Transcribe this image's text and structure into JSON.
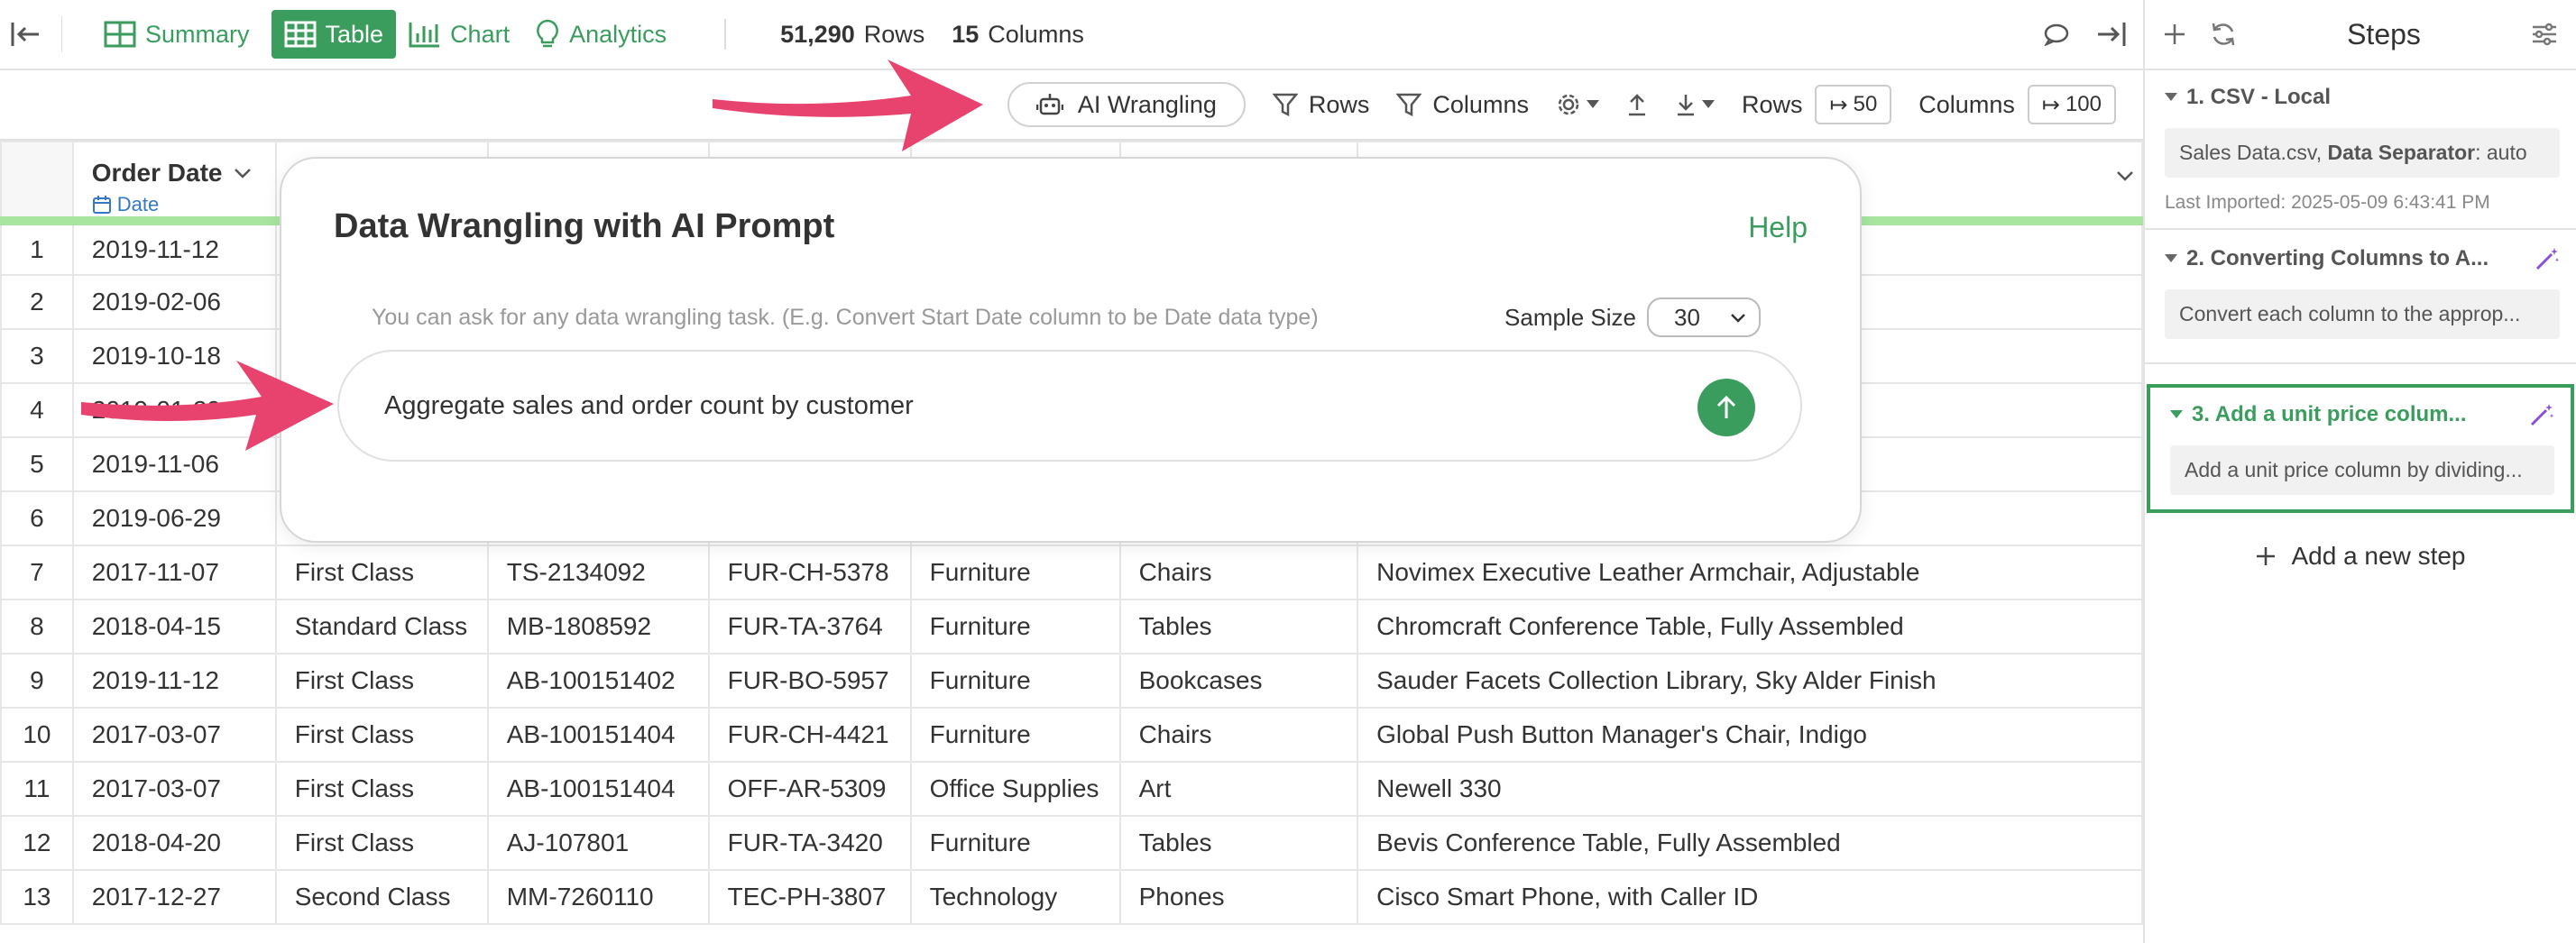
{
  "topbar": {
    "views": [
      {
        "label": "Summary",
        "icon": "summary-icon"
      },
      {
        "label": "Table",
        "icon": "table-icon"
      },
      {
        "label": "Chart",
        "icon": "bar-chart-icon"
      },
      {
        "label": "Analytics",
        "icon": "lightbulb-icon"
      }
    ],
    "rows_count": "51,290",
    "rows_label": "Rows",
    "cols_count": "15",
    "cols_label": "Columns"
  },
  "toolbar": {
    "ai_label": "AI Wrangling",
    "rows_filter": "Rows",
    "cols_filter": "Columns",
    "rows_label": "Rows",
    "rows_value": "50",
    "cols_label": "Columns",
    "cols_value": "100"
  },
  "table": {
    "header": {
      "name": "Order Date",
      "type": "Date"
    },
    "rows": [
      [
        "1",
        "2019-11-12",
        "",
        "",
        "",
        "",
        "",
        ""
      ],
      [
        "2",
        "2019-02-06",
        "",
        "",
        "",
        "",
        "",
        ""
      ],
      [
        "3",
        "2019-10-18",
        "",
        "",
        "",
        "",
        "",
        ""
      ],
      [
        "4",
        "2019-01-29",
        "",
        "",
        "",
        "",
        "",
        ""
      ],
      [
        "5",
        "2019-11-06",
        "",
        "",
        "",
        "",
        "",
        ""
      ],
      [
        "6",
        "2019-06-29",
        "",
        "",
        "",
        "",
        "",
        ""
      ],
      [
        "7",
        "2017-11-07",
        "First Class",
        "TS-2134092",
        "FUR-CH-5378",
        "Furniture",
        "Chairs",
        "Novimex Executive Leather Armchair, Adjustable"
      ],
      [
        "8",
        "2018-04-15",
        "Standard Class",
        "MB-1808592",
        "FUR-TA-3764",
        "Furniture",
        "Tables",
        "Chromcraft Conference Table, Fully Assembled"
      ],
      [
        "9",
        "2019-11-12",
        "First Class",
        "AB-100151402",
        "FUR-BO-5957",
        "Furniture",
        "Bookcases",
        "Sauder Facets Collection Library, Sky Alder Finish"
      ],
      [
        "10",
        "2017-03-07",
        "First Class",
        "AB-100151404",
        "FUR-CH-4421",
        "Furniture",
        "Chairs",
        "Global Push Button Manager's Chair, Indigo"
      ],
      [
        "11",
        "2017-03-07",
        "First Class",
        "AB-100151404",
        "OFF-AR-5309",
        "Office Supplies",
        "Art",
        "Newell 330"
      ],
      [
        "12",
        "2018-04-20",
        "First Class",
        "AJ-107801",
        "FUR-TA-3420",
        "Furniture",
        "Tables",
        "Bevis Conference Table, Fully Assembled"
      ],
      [
        "13",
        "2017-12-27",
        "Second Class",
        "MM-7260110",
        "TEC-PH-3807",
        "Technology",
        "Phones",
        "Cisco Smart Phone, with Caller ID"
      ]
    ]
  },
  "modal": {
    "title": "Data Wrangling with AI Prompt",
    "help": "Help",
    "hint": "You can ask for any data wrangling task. (E.g. Convert Start Date column to be Date data type)",
    "sample_label": "Sample Size",
    "sample_value": "30",
    "prompt": "Aggregate sales and order count by customer"
  },
  "sidebar": {
    "title": "Steps",
    "steps": [
      {
        "title": "1. CSV - Local",
        "desc_prefix": "Sales Data.csv, ",
        "desc_bold": "Data Separator",
        "desc_suffix": ": auto",
        "meta": "Last Imported: 2025-05-09 6:43:41 PM"
      },
      {
        "title": "2. Converting Columns to A...",
        "desc": "Convert each column to the approp..."
      },
      {
        "title": "3. Add a unit price colum...",
        "desc": "Add a unit price column by dividing..."
      }
    ],
    "add_step": "Add a new step"
  },
  "colors": {
    "accent": "#3a9d5d",
    "arrow": "#e8436e",
    "magic": "#8a4fd8"
  }
}
